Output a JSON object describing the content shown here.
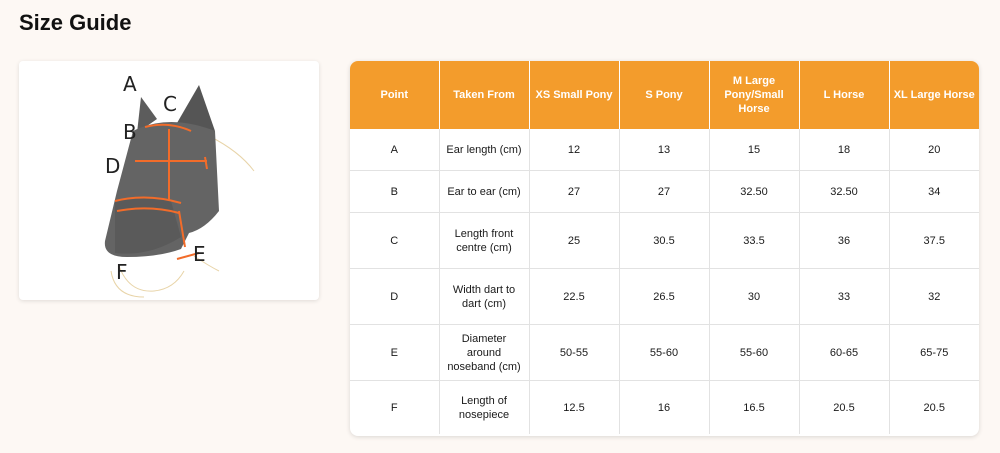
{
  "page": {
    "title": "Size Guide"
  },
  "diagram": {
    "labels": [
      "A",
      "B",
      "C",
      "D",
      "E",
      "F"
    ]
  },
  "colors": {
    "header_bg": "#f39c2c",
    "accent": "#f26c2a"
  },
  "table": {
    "headers": [
      "Point",
      "Taken From",
      "XS Small Pony",
      "S Pony",
      "M Large Pony/Small Horse",
      "L Horse",
      "XL Large Horse"
    ],
    "rows": [
      [
        "A",
        "Ear length (cm)",
        "12",
        "13",
        "15",
        "18",
        "20"
      ],
      [
        "B",
        "Ear to ear (cm)",
        "27",
        "27",
        "32.50",
        "32.50",
        "34"
      ],
      [
        "C",
        "Length front centre (cm)",
        "25",
        "30.5",
        "33.5",
        "36",
        "37.5"
      ],
      [
        "D",
        "Width dart to dart (cm)",
        "22.5",
        "26.5",
        "30",
        "33",
        "32"
      ],
      [
        "E",
        "Diameter around noseband (cm)",
        "50-55",
        "55-60",
        "55-60",
        "60-65",
        "65-75"
      ],
      [
        "F",
        "Length of nosepiece",
        "12.5",
        "16",
        "16.5",
        "20.5",
        "20.5"
      ]
    ]
  }
}
